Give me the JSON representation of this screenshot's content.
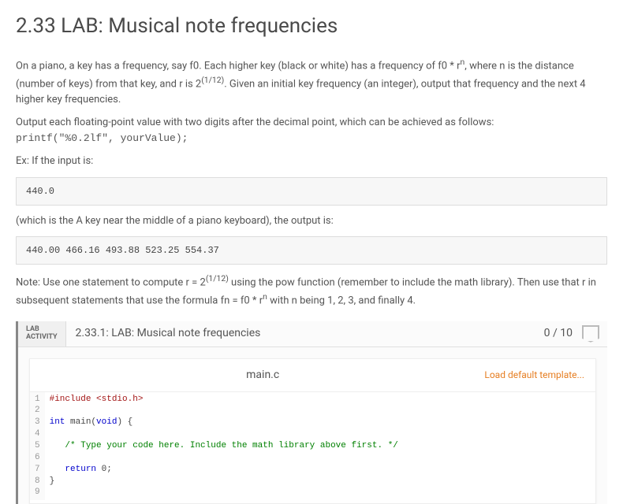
{
  "title": "2.33 LAB: Musical note frequencies",
  "para1a": "On a piano, a key has a frequency, say f0. Each higher key (black or white) has a frequency of f0 * r",
  "para1b": ", where n is the distance (number of keys) from that key, and r is 2",
  "para1c": ". Given an initial key frequency (an integer), output that frequency and the next 4 higher key frequencies.",
  "exp_n": "n",
  "exp_frac": "(1/12)",
  "para2": "Output each floating-point value with two digits after the decimal point, which can be achieved as follows:",
  "printf_line": "printf(\"%0.2lf\", yourValue);",
  "ex_label": "Ex: If the input is:",
  "input_box": "440.0",
  "mid_text": "(which is the A key near the middle of a piano keyboard), the output is:",
  "output_box": "440.00 466.16 493.88 523.25 554.37",
  "note_a": "Note: Use one statement to compute r = 2",
  "note_b": " using the pow function (remember to include the math library). Then use that r in subsequent statements that use the formula fn = f0 * r",
  "note_c": " with n being 1, 2, 3, and finally 4.",
  "lab": {
    "tag1": "LAB",
    "tag2": "ACTIVITY",
    "title": "2.33.1: LAB: Musical note frequencies",
    "score": "0 / 10"
  },
  "editor": {
    "filename": "main.c",
    "load_template": "Load default template...",
    "gutter": [
      "1",
      "2",
      "3",
      "4",
      "5",
      "6",
      "7",
      "8",
      "9"
    ],
    "code_plain": [
      "#include <stdio.h>",
      "",
      "int main(void) {",
      "",
      "   /* Type your code here. Include the math library above first. */",
      "",
      "   return 0;",
      "}",
      ""
    ]
  }
}
